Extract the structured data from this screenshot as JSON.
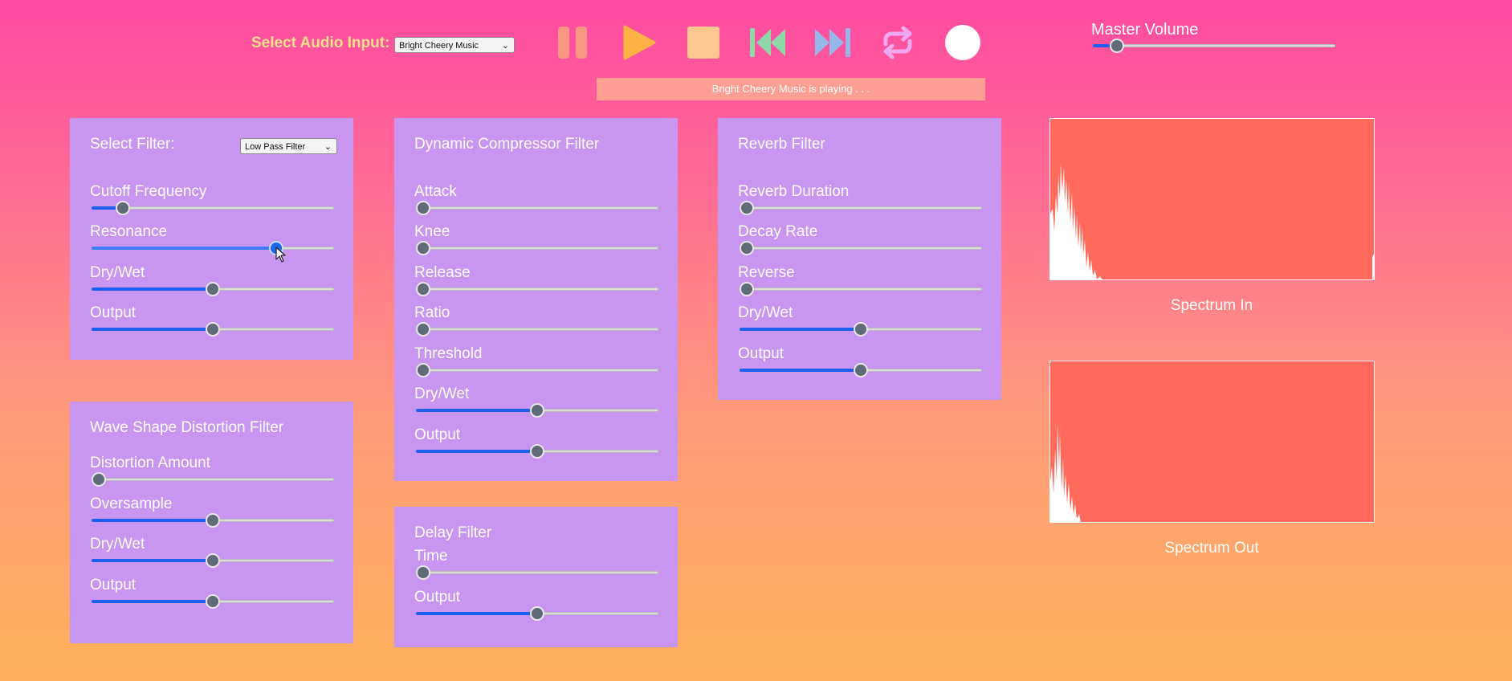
{
  "header": {
    "input_label": "Select Audio Input:",
    "input_value": "Bright Cheery Music",
    "status_text": "Bright Cheery Music is playing . . .",
    "master_volume_label": "Master Volume",
    "master_volume_value": 0.1
  },
  "controls": {
    "pause_icon": "pause-icon",
    "play_icon": "play-icon",
    "stop_icon": "stop-icon",
    "rewind_icon": "skip-back-icon",
    "forward_icon": "skip-forward-icon",
    "loop_icon": "loop-icon",
    "record_icon": "record-icon",
    "colors": {
      "pause": "#fa9783",
      "play": "#ffb244",
      "stop": "#fdc790",
      "rewind": "#8ed8a8",
      "forward": "#96b6ea",
      "loop": "#f0a8f0",
      "record": "#ffffff"
    }
  },
  "filter_panel": {
    "select_label": "Select Filter:",
    "select_value": "Low Pass Filter",
    "sliders": [
      {
        "label": "Cutoff Frequency",
        "value": 0.13
      },
      {
        "label": "Resonance",
        "value": 0.76
      },
      {
        "label": "Dry/Wet",
        "value": 0.5
      },
      {
        "label": "Output",
        "value": 0.5
      }
    ]
  },
  "distortion_panel": {
    "title": "Wave Shape Distortion Filter",
    "sliders": [
      {
        "label": "Distortion Amount",
        "value": 0.03
      },
      {
        "label": "Oversample",
        "value": 0.5
      },
      {
        "label": "Dry/Wet",
        "value": 0.5
      },
      {
        "label": "Output",
        "value": 0.5
      }
    ]
  },
  "compressor_panel": {
    "title": "Dynamic Compressor Filter",
    "sliders": [
      {
        "label": "Attack",
        "value": 0.03
      },
      {
        "label": "Knee",
        "value": 0.03
      },
      {
        "label": "Release",
        "value": 0.03
      },
      {
        "label": "Ratio",
        "value": 0.03
      },
      {
        "label": "Threshold",
        "value": 0.03
      },
      {
        "label": "Dry/Wet",
        "value": 0.5
      },
      {
        "label": "Output",
        "value": 0.5
      }
    ]
  },
  "delay_panel": {
    "title": "Delay Filter",
    "sliders": [
      {
        "label": "Time",
        "value": 0.03
      },
      {
        "label": "Output",
        "value": 0.5
      }
    ]
  },
  "reverb_panel": {
    "title": "Reverb Filter",
    "sliders": [
      {
        "label": "Reverb Duration",
        "value": 0.03
      },
      {
        "label": "Decay Rate",
        "value": 0.03
      },
      {
        "label": "Reverse",
        "value": 0.03
      },
      {
        "label": "Dry/Wet",
        "value": 0.5
      },
      {
        "label": "Output",
        "value": 0.5
      }
    ]
  },
  "spectrum": {
    "in_label": "Spectrum In",
    "out_label": "Spectrum Out",
    "background_color": "#ff6a5c"
  }
}
